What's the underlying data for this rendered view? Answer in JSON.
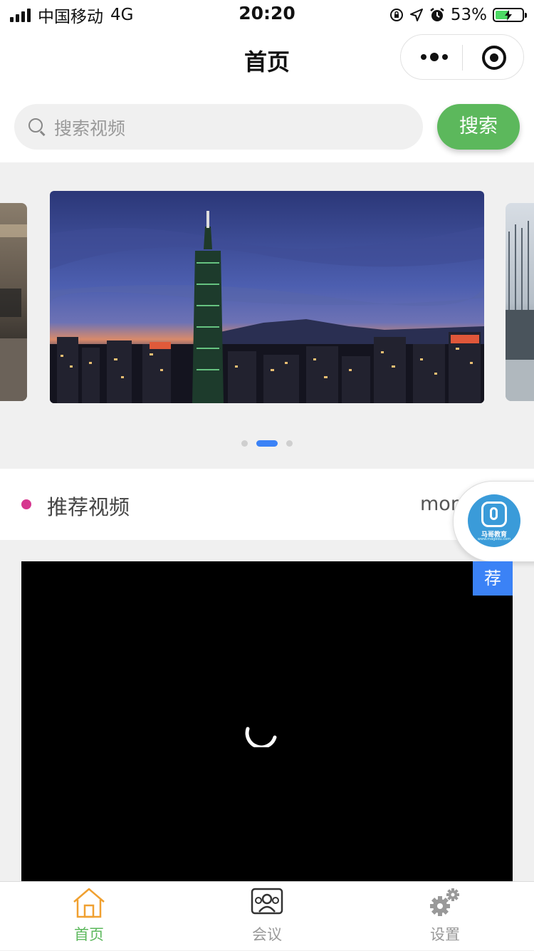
{
  "status_bar": {
    "carrier": "中国移动",
    "network": "4G",
    "time": "20:20",
    "battery_percent": "53%",
    "battery_level": 0.53,
    "battery_color": "#4cd964"
  },
  "nav": {
    "title": "首页",
    "menu_icon": "more-dots-icon",
    "close_icon": "target-circle-icon"
  },
  "search": {
    "placeholder": "搜索视频",
    "button_label": "搜索",
    "button_color": "#5cb85c"
  },
  "banner": {
    "slides": [
      {
        "subject": "conference-room"
      },
      {
        "subject": "city-skyline-night-tower"
      },
      {
        "subject": "building-exterior"
      }
    ],
    "active_index": 1,
    "indicator_color": "#3b82f6"
  },
  "section": {
    "title": "推荐视频",
    "more_label": "mor",
    "bullet_color": "#d6378f"
  },
  "float_logo": {
    "brand": "马哥教育",
    "url": "www.magedu.com"
  },
  "video": {
    "badge": "荐",
    "state": "loading",
    "badge_color": "#3b82f6"
  },
  "tabbar": {
    "items": [
      {
        "label": "首页",
        "icon": "home-icon",
        "active": true
      },
      {
        "label": "会议",
        "icon": "meeting-people-icon",
        "active": false
      },
      {
        "label": "设置",
        "icon": "gear-icon",
        "active": false
      }
    ],
    "active_color": "#5cb85c",
    "active_icon_color": "#f0a030"
  }
}
